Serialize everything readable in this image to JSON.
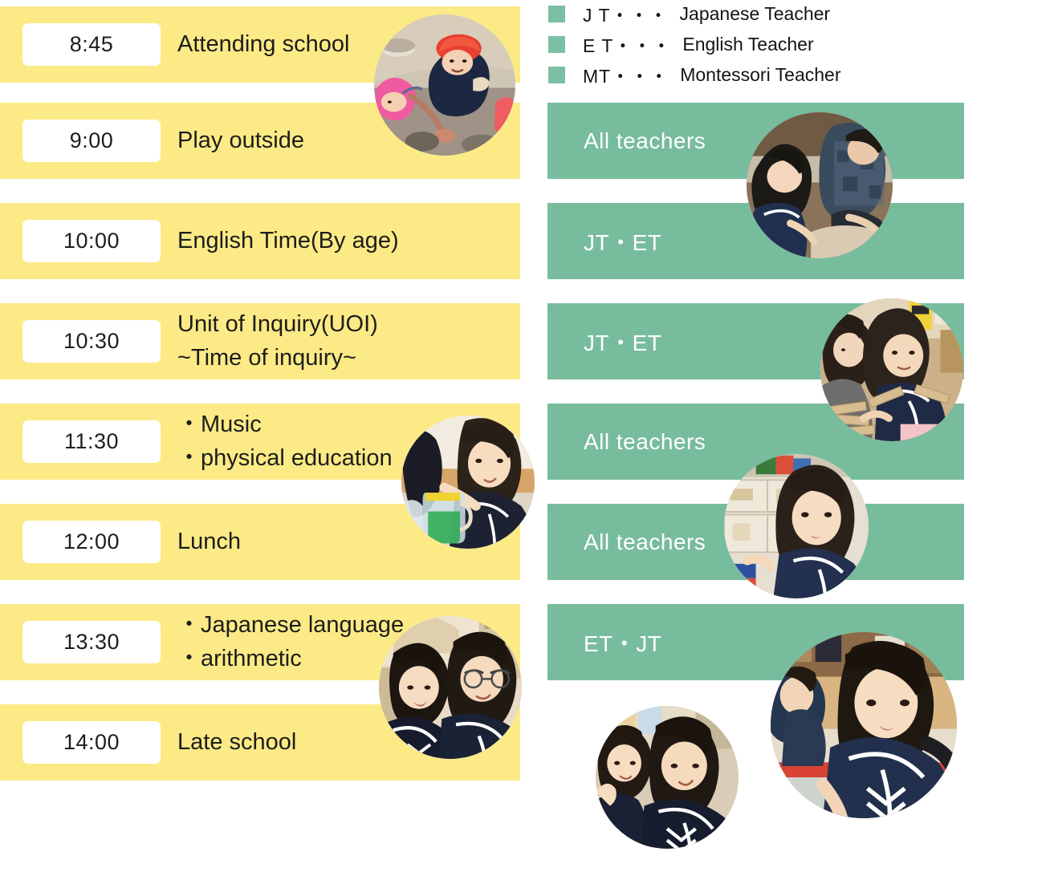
{
  "colors": {
    "row_yellow": "#fcea86",
    "row_green": "#78bc9e",
    "legend_swatch": "#7cc0a4",
    "time_chip_bg": "#ffffff",
    "text_dark": "#1d1d1b",
    "text_light": "#ffffff",
    "page_bg": "#ffffff"
  },
  "legend": {
    "items": [
      {
        "swatch": "green-swatch-icon",
        "abbr": "J T・・・",
        "full": "Japanese Teacher"
      },
      {
        "swatch": "green-swatch-icon",
        "abbr": "E T・・・",
        "full": "English Teacher"
      },
      {
        "swatch": "green-swatch-icon",
        "abbr": "MT・・・",
        "full": "Montessori Teacher"
      }
    ]
  },
  "schedule": {
    "rows": [
      {
        "time": "8:45",
        "lines": [
          "Attending school"
        ]
      },
      {
        "time": "9:00",
        "lines": [
          "Play outside"
        ]
      },
      {
        "time": "10:00",
        "lines": [
          "English Time(By age)"
        ]
      },
      {
        "time": "10:30",
        "lines": [
          "Unit of Inquiry(UOI)",
          "~Time of inquiry~"
        ]
      },
      {
        "time": "11:30",
        "lines": [
          "・Music",
          "・physical education"
        ]
      },
      {
        "time": "12:00",
        "lines": [
          "Lunch"
        ]
      },
      {
        "time": "13:30",
        "lines": [
          "・Japanese language",
          "・arithmetic"
        ]
      },
      {
        "time": "14:00",
        "lines": [
          "Late school"
        ]
      }
    ]
  },
  "teachers": {
    "rows": [
      {
        "label": "All teachers"
      },
      {
        "label": "JT・ET"
      },
      {
        "label": "JT・ET"
      },
      {
        "label": "All teachers"
      },
      {
        "label": "All teachers"
      },
      {
        "label": "ET・JT"
      }
    ]
  },
  "photos": [
    {
      "name": "photo-sandbox-play"
    },
    {
      "name": "photo-water-pouring"
    },
    {
      "name": "photo-two-boys-looking-up"
    },
    {
      "name": "photo-teacher-and-girl-writing"
    },
    {
      "name": "photo-boy-with-wooden-blocks"
    },
    {
      "name": "photo-girl-with-colored-blocks"
    },
    {
      "name": "photo-children-waving"
    },
    {
      "name": "photo-girl-on-balance-beam"
    }
  ]
}
